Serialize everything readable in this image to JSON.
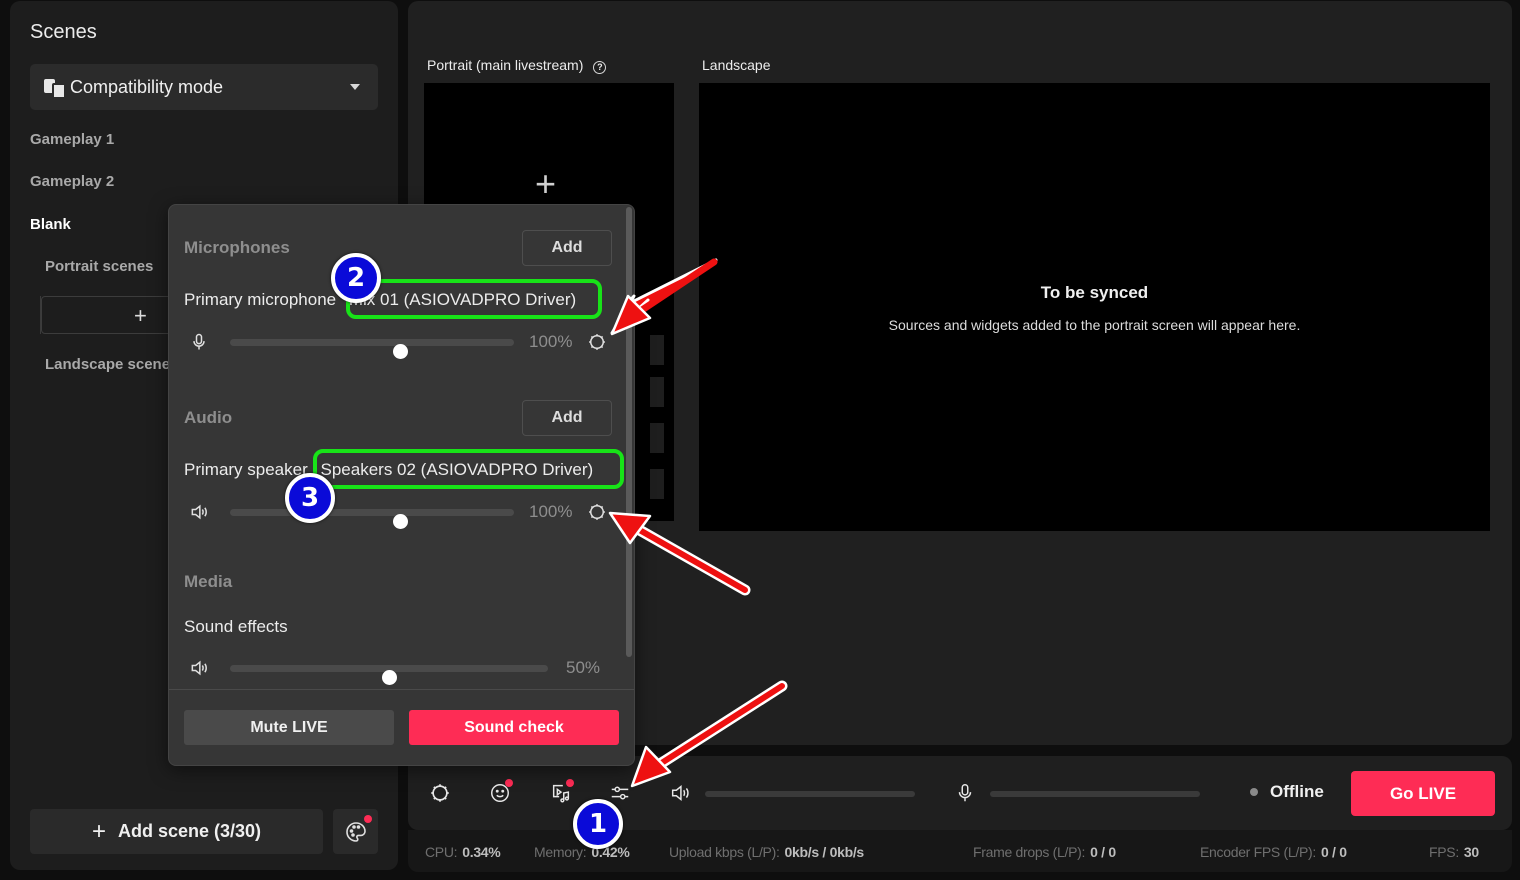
{
  "scenes": {
    "title": "Scenes",
    "mode_selector": {
      "icon": "compatibility-mode-icon",
      "label": "Compatibility mode"
    },
    "items": [
      {
        "label": "Gameplay 1",
        "active": false
      },
      {
        "label": "Gameplay 2",
        "active": false
      },
      {
        "label": "Blank",
        "active": true
      }
    ],
    "portrait_scenes_label": "Portrait scenes",
    "portrait_add_label": "+",
    "landscape_scenes_label": "Landscape scenes",
    "add_scene_label": "Add scene (3/30)",
    "theme_icon": "palette-icon"
  },
  "preview": {
    "portrait_label": "Portrait (main livestream)",
    "portrait_help_icon": "?",
    "portrait_add": "+",
    "landscape_label": "Landscape",
    "sync_title": "To be synced",
    "sync_subtitle": "Sources and widgets added to the portrait screen will appear here."
  },
  "audio_popover": {
    "microphones": {
      "title": "Microphones",
      "add_label": "Add",
      "device_prefix": "Primary microphone",
      "device_name": "Mix 01 (ASIOVADPRO Driver)",
      "volume_percent": 100,
      "volume_label": "100%",
      "slider_position": 0.6
    },
    "audio": {
      "title": "Audio",
      "add_label": "Add",
      "device_prefix": "Primary speaker",
      "device_name": "Speakers 02 (ASIOVADPRO Driver)",
      "volume_percent": 100,
      "volume_label": "100%",
      "slider_position": 0.6
    },
    "media": {
      "title": "Media",
      "item_label": "Sound effects",
      "volume_percent": 50,
      "volume_label": "50%",
      "slider_position": 0.5
    },
    "mute_label": "Mute LIVE",
    "sound_check_label": "Sound check"
  },
  "control_bar": {
    "icons": [
      "settings-icon",
      "effects-icon",
      "media-music-icon",
      "audio-mixer-icon",
      "speaker-icon",
      "microphone-icon"
    ],
    "status_label": "Offline",
    "go_live_label": "Go LIVE"
  },
  "stats": {
    "cpu_label": "CPU:",
    "cpu_value": "0.34%",
    "memory_label": "Memory:",
    "memory_value": "0.42%",
    "upload_label": "Upload kbps (L/P):",
    "upload_value": "0kb/s / 0kb/s",
    "frame_drops_label": "Frame drops (L/P):",
    "frame_drops_value": "0 / 0",
    "encoder_fps_label": "Encoder FPS (L/P):",
    "encoder_fps_value": "0 / 0",
    "fps_label": "FPS:",
    "fps_value": "30"
  },
  "annotations": {
    "steps": [
      "1",
      "2",
      "3"
    ]
  },
  "colors": {
    "accent": "#fe2c55",
    "highlight": "#18e318",
    "step_badge": "#0a0ad8",
    "arrow": "#ee1111"
  }
}
